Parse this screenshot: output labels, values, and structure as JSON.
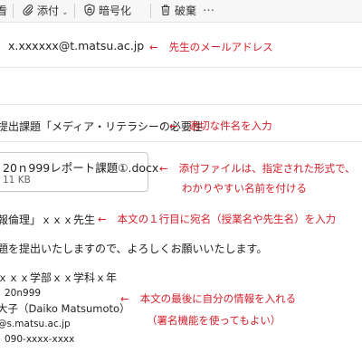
{
  "toolbar": {
    "link_label": "看",
    "attach_label": "添付",
    "encrypt_label": "暗号化",
    "discard_label": "破棄",
    "more_label": "…"
  },
  "to": {
    "value": "x.xxxxxx@t.matsu.ac.jp",
    "annotation": "先生のメールアドレス"
  },
  "subject": {
    "value": "提出課題「メディア・リテラシーの必要性",
    "annotation": "適切な件名を入力"
  },
  "attachment": {
    "filename": "20ｎ999レポート課題①.docx",
    "size": "11 KB",
    "annotation_line1": "添付ファイルは、指定された形式で、",
    "annotation_line2": "わかりやすい名前を付ける"
  },
  "body": {
    "greeting": "報倫理」ｘｘｘ先生",
    "greeting_annotation": "本文の１行目に宛名（授業名や先生名）を入力",
    "line1": "題を提出いたしますので、よろしくお願いいたします。",
    "sig_dept": "ｘｘｘ学部ｘｘ学科ｘ年",
    "sig_id": "20n999",
    "sig_name": "大子（Daiko Matsumoto）",
    "sig_email": "@s.matsu.ac.jp",
    "sig_phone": "090-xxxx-xxxx",
    "sig_annotation_line1": "本文の最後に自分の情報を入れる",
    "sig_annotation_line2": "（署名機能を使ってもよい）"
  },
  "colors": {
    "annotation": "#d4202b",
    "toolbar_icon": "#3a3a3a"
  },
  "icons": {
    "link": "link-icon",
    "attach": "paperclip-icon",
    "encrypt": "shield-lock-icon",
    "discard": "trash-icon",
    "more": "more-icon"
  }
}
